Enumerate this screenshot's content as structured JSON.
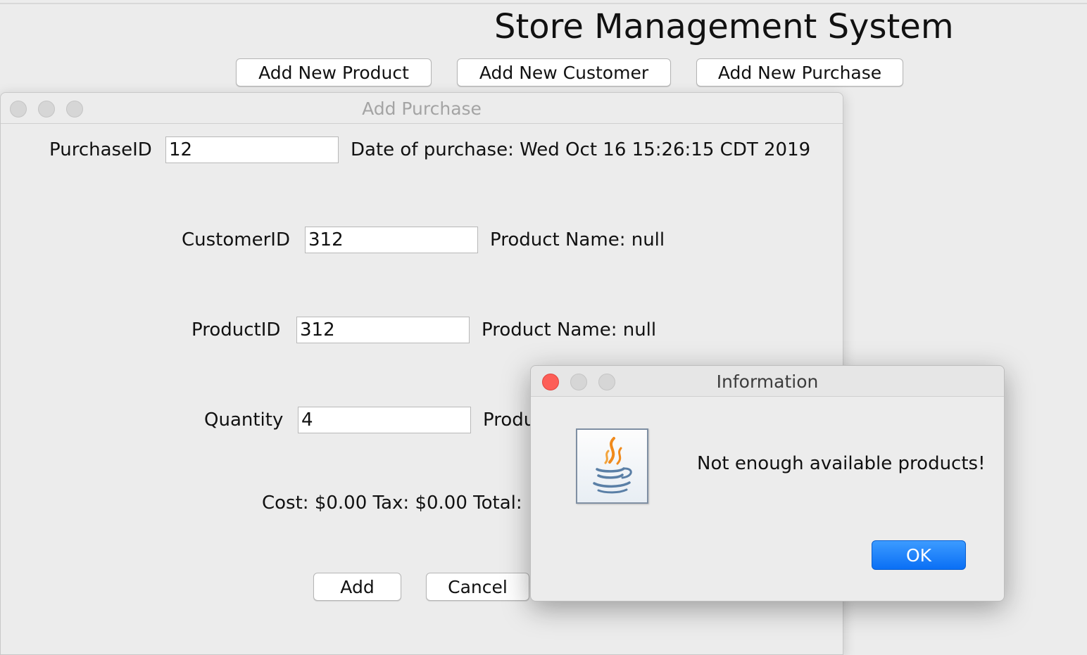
{
  "main": {
    "title": "Store Management System",
    "buttons": {
      "add_product": "Add New Product",
      "add_customer": "Add New Customer",
      "add_purchase": "Add New Purchase"
    }
  },
  "purchase_dialog": {
    "title": "Add Purchase",
    "purchase_id_label": "PurchaseID",
    "purchase_id_value": "12",
    "date_text": "Date of purchase: Wed Oct 16 15:26:15 CDT 2019",
    "customer_id_label": "CustomerID",
    "customer_id_value": "312",
    "customer_info": "Product Name: null",
    "product_id_label": "ProductID",
    "product_id_value": "312",
    "product_info": "Product Name: null",
    "quantity_label": "Quantity",
    "quantity_value": "4",
    "quantity_info_partial": "Produ",
    "totals_text": "Cost: $0.00 Tax: $0.00 Total:",
    "add_label": "Add",
    "cancel_label": "Cancel"
  },
  "alert": {
    "title": "Information",
    "message": "Not enough available products!",
    "ok_label": "OK",
    "icon": "java-coffee-cup-icon"
  },
  "colors": {
    "window_bg": "#ececec",
    "ok_button": "#1a7cf8",
    "close_red": "#fd5e57"
  }
}
